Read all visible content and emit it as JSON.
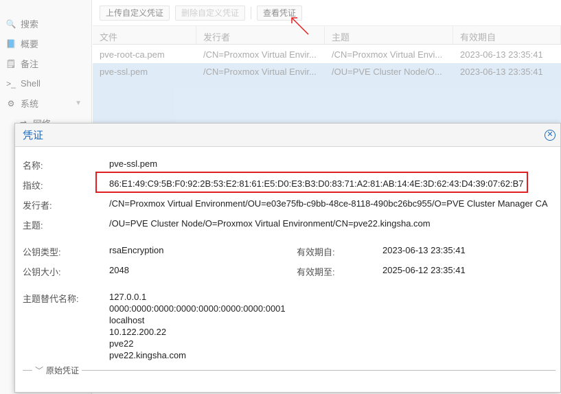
{
  "sidebar": {
    "items": [
      {
        "icon": "search-icon",
        "glyph": "🔍",
        "label": "搜索"
      },
      {
        "icon": "book-icon",
        "glyph": "📘",
        "label": "概要"
      },
      {
        "icon": "note-icon",
        "glyph": "🗒",
        "label": "备注"
      },
      {
        "icon": "terminal-icon",
        "glyph": ">_",
        "label": "Shell"
      },
      {
        "icon": "gears-icon",
        "glyph": "⚙",
        "label": "系统"
      },
      {
        "icon": "network-icon",
        "glyph": "⇄",
        "label": "网络"
      }
    ]
  },
  "toolbar": {
    "upload_label": "上传自定义凭证",
    "delete_label": "删除自定义凭证",
    "view_label": "查看凭证"
  },
  "grid": {
    "columns": [
      "文件",
      "发行者",
      "主题",
      "有效期自"
    ],
    "rows": [
      {
        "file": "pve-root-ca.pem",
        "issuer": "/CN=Proxmox Virtual Envir...",
        "subject": "/CN=Proxmox Virtual Envi...",
        "from": "2023-06-13 23:35:41"
      },
      {
        "file": "pve-ssl.pem",
        "issuer": "/CN=Proxmox Virtual Envir...",
        "subject": "/OU=PVE Cluster Node/O...",
        "from": "2023-06-13 23:35:41"
      }
    ]
  },
  "modal": {
    "title": "凭证",
    "name_label": "名称:",
    "name_value": "pve-ssl.pem",
    "fingerprint_label": "指纹:",
    "fingerprint_value": "86:E1:49:C9:5B:F0:92:2B:53:E2:81:61:E5:D0:E3:B3:D0:83:71:A2:81:AB:14:4E:3D:62:43:D4:39:07:62:B7",
    "issuer_label": "发行者:",
    "issuer_value": "/CN=Proxmox Virtual Environment/OU=e03e75fb-c9bb-48ce-8118-490bc26bc955/O=PVE Cluster Manager CA",
    "subject_label": "主题:",
    "subject_value": "/OU=PVE Cluster Node/O=Proxmox Virtual Environment/CN=pve22.kingsha.com",
    "pubkey_type_label": "公钥类型:",
    "pubkey_type_value": "rsaEncryption",
    "pubkey_size_label": "公钥大小:",
    "pubkey_size_value": "2048",
    "valid_from_label": "有效期自:",
    "valid_from_value": "2023-06-13 23:35:41",
    "valid_to_label": "有效期至:",
    "valid_to_value": "2025-06-12 23:35:41",
    "san_label": "主题替代名称:",
    "san_values": [
      "127.0.0.1",
      "0000:0000:0000:0000:0000:0000:0000:0001",
      "localhost",
      "10.122.200.22",
      "pve22",
      "pve22.kingsha.com"
    ],
    "raw_label": "原始凭证"
  },
  "colors": {
    "accent": "#1f6bbf",
    "highlight_box": "#e02020",
    "selection": "#c6dcf2"
  }
}
